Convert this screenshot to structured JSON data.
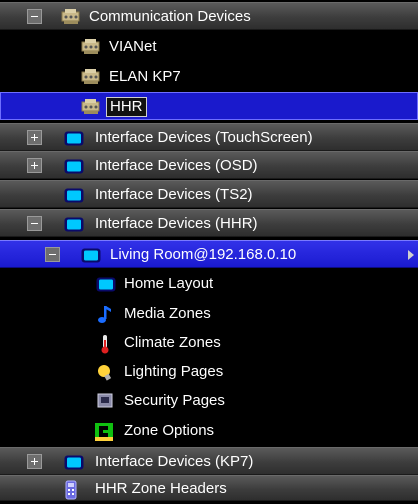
{
  "tree": {
    "comm_devices": "Communication Devices",
    "vianet": "VIANet",
    "elan_kp7": "ELAN KP7",
    "hhr": "HHR",
    "if_touchscreen": "Interface Devices (TouchScreen)",
    "if_osd": "Interface Devices (OSD)",
    "if_ts2": "Interface Devices (TS2)",
    "if_hhr": "Interface Devices (HHR)",
    "living_room": "Living Room@192.168.0.10",
    "home_layout": "Home Layout",
    "media_zones": "Media Zones",
    "climate_zones": "Climate Zones",
    "lighting_pages": "Lighting Pages",
    "security_pages": "Security Pages",
    "zone_options": "Zone Options",
    "if_kp7": "Interface Devices (KP7)",
    "hhr_zone_headers": "HHR Zone Headers"
  },
  "colors": {
    "selection": "#1a1acc",
    "header_gradient_top": "#5a5a5a",
    "screen_icon": "#00c8ff"
  }
}
